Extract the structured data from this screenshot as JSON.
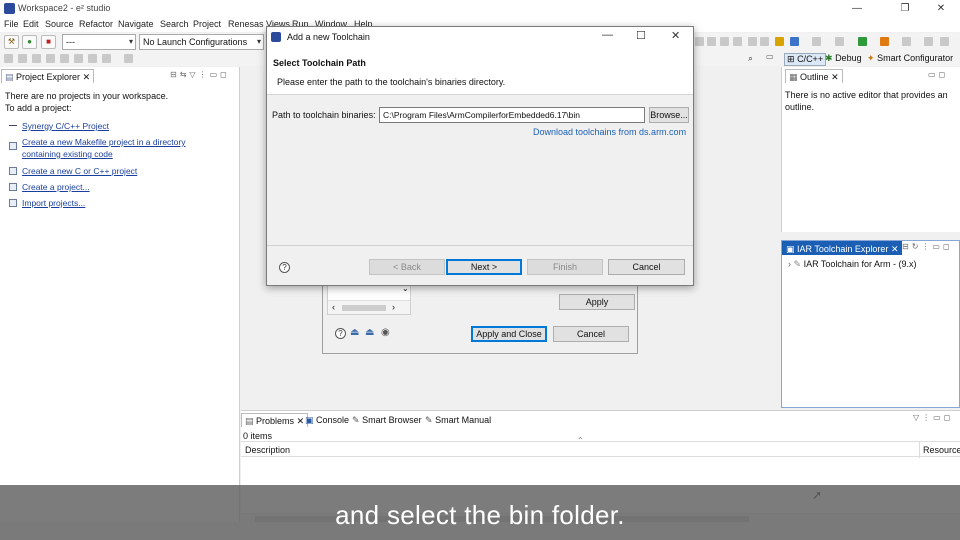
{
  "window": {
    "title": "Workspace2 - e² studio",
    "controls": {
      "minimize": "—",
      "restore": "❐",
      "close": "✕"
    }
  },
  "menu": [
    "File",
    "Edit",
    "Source",
    "Refactor",
    "Navigate",
    "Search",
    "Project",
    "Renesas Views",
    "Run",
    "Window",
    "Help"
  ],
  "toolbar": {
    "mode_combo": "---",
    "launch_combo": "No Launch Configurations"
  },
  "perspectives": {
    "cpp": "C/C++",
    "debug": "Debug",
    "smart_configurator": "Smart Configurator"
  },
  "project_explorer": {
    "tab": "Project Explorer",
    "intro_line1": "There are no projects in your workspace.",
    "intro_line2": "To add a project:",
    "links": [
      "Synergy C/C++ Project",
      "Create a new Makefile project in a directory",
      "containing existing code",
      "Create a new C or C++ project",
      "Create a project...",
      "Import projects..."
    ]
  },
  "outline": {
    "tab": "Outline",
    "message": "There is no active editor that provides an outline."
  },
  "iar_explorer": {
    "tab": "IAR Toolchain Explorer",
    "item": "IAR Toolchain for Arm - (9.x)"
  },
  "problems": {
    "tabs": [
      "Problems",
      "Console",
      "Smart Browser",
      "Smart Manual"
    ],
    "count": "0 items",
    "columns": [
      "Description",
      "Resource"
    ]
  },
  "prefs_dialog": {
    "apply": "Apply",
    "apply_close": "Apply and Close",
    "cancel": "Cancel"
  },
  "toolchain_dialog": {
    "title": "Add a new Toolchain",
    "heading": "Select Toolchain Path",
    "description": "Please enter the path to the toolchain's binaries directory.",
    "path_label": "Path to toolchain binaries:",
    "path_value": "C:\\Program Files\\ArmCompilerforEmbedded6.17\\bin",
    "browse": "Browse...",
    "download_link": "Download toolchains from ds.arm.com",
    "back": "< Back",
    "next": "Next >",
    "finish": "Finish",
    "cancel": "Cancel"
  },
  "caption": "and select the bin folder."
}
